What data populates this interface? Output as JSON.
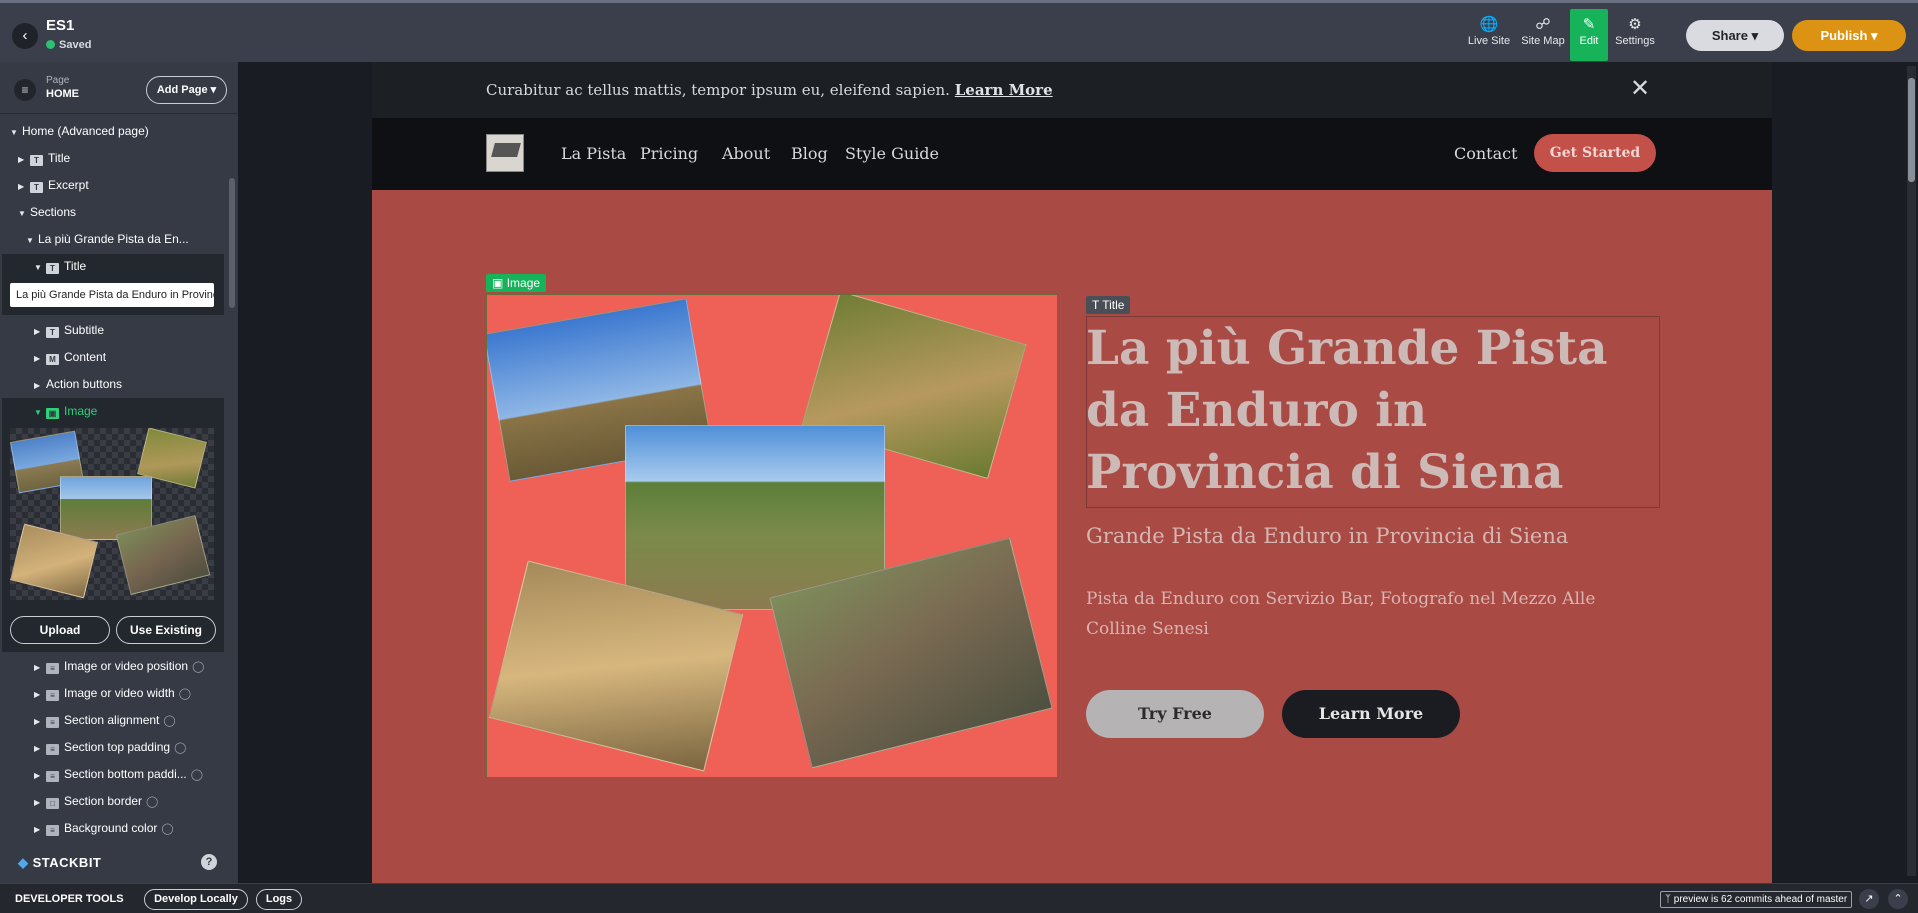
{
  "topbar": {
    "site_name": "ES1",
    "status": "Saved",
    "tools": [
      {
        "label": "Live Site",
        "icon": "globe-icon"
      },
      {
        "label": "Site Map",
        "icon": "sitemap-icon"
      },
      {
        "label": "Edit",
        "icon": "pencil-icon"
      },
      {
        "label": "Settings",
        "icon": "gear-icon"
      }
    ],
    "share_label": "Share",
    "publish_label": "Publish",
    "colors": {
      "edit_active": "#16b35a",
      "publish": "#dc9212"
    }
  },
  "left_panel": {
    "page_label": "Page",
    "page_value": "HOME",
    "add_page_label": "Add Page",
    "tree": {
      "home": "Home (Advanced page)",
      "title": "Title",
      "excerpt": "Excerpt",
      "sections": "Sections",
      "section_name": "La più Grande Pista da En...",
      "section_title": "Title",
      "title_value": "La più Grande Pista da Enduro in Provincia di Siena",
      "subtitle": "Subtitle",
      "content": "Content",
      "action_buttons": "Action buttons",
      "image": "Image"
    },
    "upload_label": "Upload",
    "use_existing_label": "Use Existing",
    "fields": [
      "Image or video position",
      "Image or video width",
      "Section alignment",
      "Section top padding",
      "Section bottom paddi...",
      "Section border",
      "Background color"
    ],
    "brand": "STACKBIT",
    "help": "?"
  },
  "site": {
    "banner_text": "Curabitur ac tellus mattis, tempor ipsum eu, eleifend sapien.",
    "banner_link": "Learn More",
    "nav_items": [
      "La Pista",
      "Pricing",
      "About",
      "Blog",
      "Style Guide"
    ],
    "contact": "Contact",
    "get_started": "Get Started",
    "image_tag": "Image",
    "title_tag": "Title",
    "hero_title": "La più Grande Pista da Enduro in Provincia di Siena",
    "hero_subtitle": "Grande Pista da Enduro in Provincia di Siena",
    "hero_body": "Pista da Enduro con Servizio Bar, Fotografo nel Mezzo Alle Colline Senesi",
    "try_free": "Try Free",
    "learn_more": "Learn More",
    "colors": {
      "section_bg": "#a94a44",
      "image_bg": "#ef6157",
      "cta_dark": "#1a1c21"
    }
  },
  "bottombar": {
    "label": "DEVELOPER TOOLS",
    "develop_locally": "Develop Locally",
    "logs": "Logs",
    "commits": "preview is 62 commits ahead of master"
  }
}
